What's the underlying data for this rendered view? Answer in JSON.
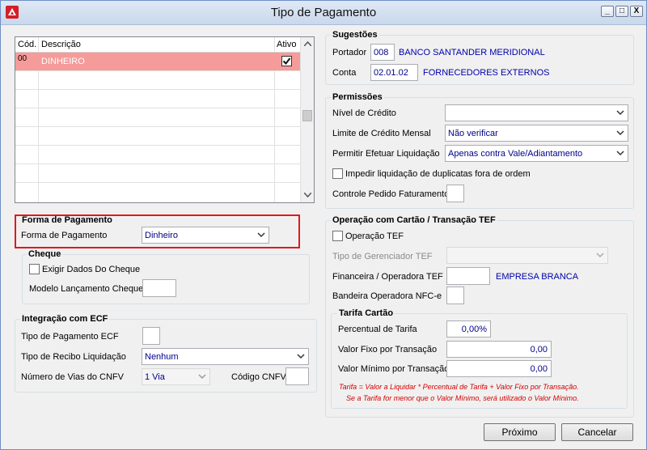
{
  "window": {
    "title": "Tipo de Pagamento",
    "min_label": "_",
    "max_label": "□",
    "close_label": "X"
  },
  "grid": {
    "columns": [
      "Cód.",
      "Descrição",
      "Ativo"
    ],
    "rows": [
      {
        "code": "00",
        "description": "DINHEIRO",
        "active": true
      }
    ],
    "selected_color": "#f59b99"
  },
  "sugestoes": {
    "title": "Sugestões",
    "portador_label": "Portador",
    "portador_code": "008",
    "portador_name": "BANCO SANTANDER MERIDIONAL",
    "conta_label": "Conta",
    "conta_code": "02.01.02",
    "conta_name": "FORNECEDORES EXTERNOS"
  },
  "permissoes": {
    "title": "Permissões",
    "nivel_credito_label": "Nível de Crédito",
    "nivel_credito_value": "",
    "limite_label": "Limite de Crédito Mensal",
    "limite_value": "Não verificar",
    "efetuar_label": "Permitir Efetuar Liquidação",
    "efetuar_value": "Apenas contra Vale/Adiantamento",
    "impedir_label": "Impedir liquidação de duplicatas fora de ordem",
    "impedir_checked": false,
    "controle_label": "Controle Pedido Faturamento",
    "controle_value": ""
  },
  "forma_pagamento": {
    "title": "Forma de Pagamento",
    "label": "Forma de Pagamento",
    "value": "Dinheiro",
    "highlight_color": "#e0191e"
  },
  "cheque": {
    "title": "Cheque",
    "exigir_label": "Exigir Dados Do Cheque",
    "exigir_checked": false,
    "modelo_label": "Modelo Lançamento Cheque",
    "modelo_value": ""
  },
  "ecf": {
    "title": "Integração com ECF",
    "tipo_pagamento_label": "Tipo de Pagamento ECF",
    "tipo_pagamento_value": "",
    "tipo_recibo_label": "Tipo de Recibo Liquidação",
    "tipo_recibo_value": "Nenhum",
    "vias_label": "Número de Vias do CNFV",
    "vias_value": "1 Via",
    "codigo_label": "Código CNFV",
    "codigo_value": ""
  },
  "tef": {
    "title": "Operação com Cartão / Transação TEF",
    "operacao_label": "Operação TEF",
    "operacao_checked": false,
    "gerenciador_label": "Tipo de Gerenciador TEF",
    "gerenciador_value": "",
    "financeira_label": "Financeira / Operadora TEF",
    "financeira_code": "",
    "financeira_name": "EMPRESA BRANCA",
    "bandeira_label": "Bandeira Operadora NFC-e",
    "bandeira_value": ""
  },
  "tarifa": {
    "title": "Tarifa Cartão",
    "percentual_label": "Percentual de Tarifa",
    "percentual_value": "0,00%",
    "fixo_label": "Valor Fixo por Transação",
    "fixo_value": "0,00",
    "minimo_label": "Valor Mínimo por Transação",
    "minimo_value": "0,00",
    "note_line1": "Tarifa = Valor a Liquidar *  Percentual de Tarifa + Valor Fixo por Transação.",
    "note_line2": "Se a Tarifa for menor que o Valor Mínimo, será utilizado o Valor Mínimo."
  },
  "footer": {
    "next_label": "Próximo",
    "cancel_label": "Cancelar"
  }
}
